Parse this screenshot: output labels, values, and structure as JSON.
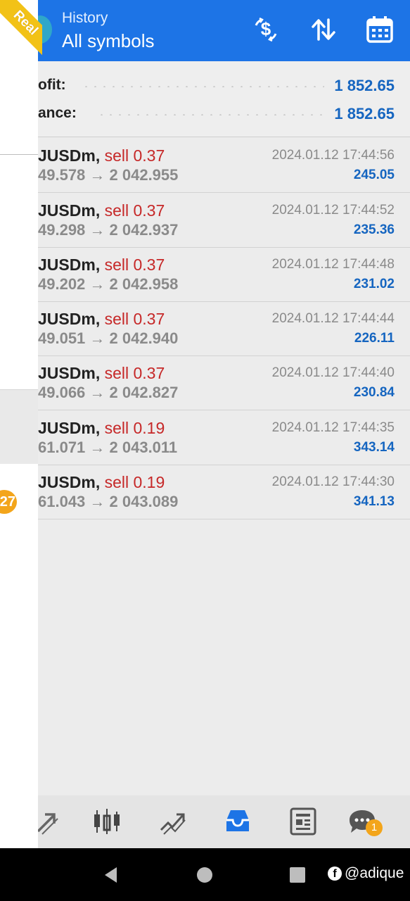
{
  "header": {
    "title": "History",
    "subtitle": "All symbols"
  },
  "account": {
    "ribbon": "Real"
  },
  "summary": [
    {
      "label": "ofit:",
      "value": "1 852.65"
    },
    {
      "label": "ance:",
      "value": "1 852.65"
    }
  ],
  "deals": [
    {
      "symbol": "JUSDm",
      "side": "sell 0.37",
      "prices": "49.578 → 2 042.955",
      "time": "2024.01.12 17:44:56",
      "profit": "245.05"
    },
    {
      "symbol": "JUSDm",
      "side": "sell 0.37",
      "prices": "49.298 → 2 042.937",
      "time": "2024.01.12 17:44:52",
      "profit": "235.36"
    },
    {
      "symbol": "JUSDm",
      "side": "sell 0.37",
      "prices": "49.202 → 2 042.958",
      "time": "2024.01.12 17:44:48",
      "profit": "231.02"
    },
    {
      "symbol": "JUSDm",
      "side": "sell 0.37",
      "prices": "49.051 → 2 042.940",
      "time": "2024.01.12 17:44:44",
      "profit": "226.11"
    },
    {
      "symbol": "JUSDm",
      "side": "sell 0.37",
      "prices": "49.066 → 2 042.827",
      "time": "2024.01.12 17:44:40",
      "profit": "230.84"
    },
    {
      "symbol": "JUSDm",
      "side": "sell 0.19",
      "prices": "61.071 → 2 043.011",
      "time": "2024.01.12 17:44:35",
      "profit": "343.14"
    },
    {
      "symbol": "JUSDm",
      "side": "sell 0.19",
      "prices": "61.043 → 2 043.089",
      "time": "2024.01.12 17:44:30",
      "profit": "341.13"
    }
  ],
  "drawer": {
    "badge": "27"
  },
  "nav": {
    "items": [
      "quotes-icon",
      "chart-icon",
      "trade-icon",
      "history-icon",
      "news-icon",
      "chat-icon"
    ],
    "active": "history-icon",
    "chat_badge": "1"
  },
  "watermark": "@adique",
  "colors": {
    "header": "#1d74e6",
    "accent_blue": "#1565c0",
    "sell_red": "#c62828",
    "badge_orange": "#f3a51b",
    "ribbon_yellow": "#f2c217"
  }
}
